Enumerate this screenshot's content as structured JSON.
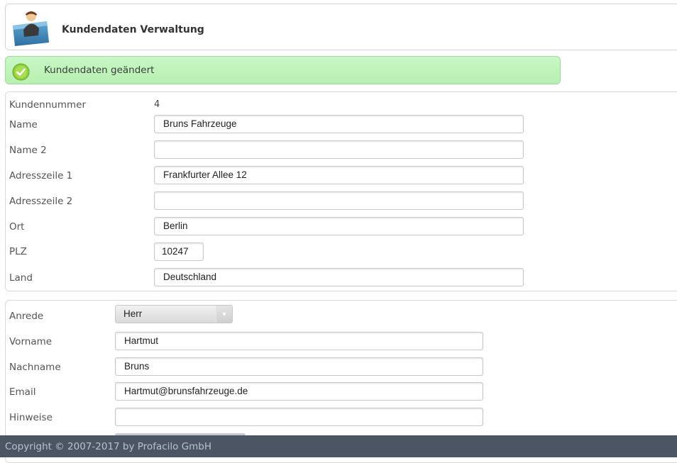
{
  "header": {
    "title": "Kundendaten Verwaltung",
    "icon": "customer-folder-icon"
  },
  "notice": {
    "message": "Kundendaten geändert",
    "icon": "check-circle-icon",
    "color": "#c3f5be"
  },
  "address": {
    "kundennummer_label": "Kundennummer",
    "kundennummer_value": "4",
    "name_label": "Name",
    "name_value": "Bruns Fahrzeuge",
    "name2_label": "Name 2",
    "name2_value": "",
    "adresse1_label": "Adresszeile 1",
    "adresse1_value": "Frankfurter Allee 12",
    "adresse2_label": "Adresszeile 2",
    "adresse2_value": "",
    "ort_label": "Ort",
    "ort_value": "Berlin",
    "plz_label": "PLZ",
    "plz_value": "10247",
    "land_label": "Land",
    "land_value": "Deutschland"
  },
  "contact": {
    "anrede_label": "Anrede",
    "anrede_value": "Herr",
    "vorname_label": "Vorname",
    "vorname_value": "Hartmut",
    "nachname_label": "Nachname",
    "nachname_value": "Bruns",
    "email_label": "Email",
    "email_value": "Hartmut@brunsfahrzeuge.de",
    "hinweise_label": "Hinweise",
    "hinweise_value": ""
  },
  "footer": {
    "copyright": "Copyright © 2007-2017 by Profacilo GmbH",
    "background": "#4b5563"
  }
}
